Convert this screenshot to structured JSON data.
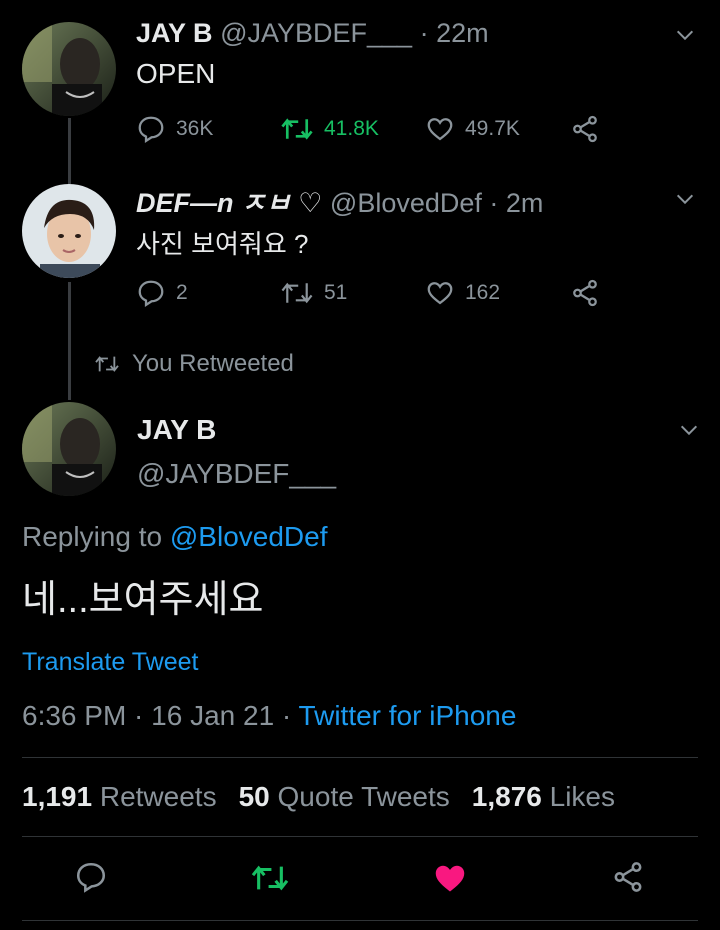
{
  "tweet1": {
    "name": "JAY B",
    "handle": "@JAYBDEF___",
    "time": "· 22m",
    "text": "OPEN",
    "replies": "36K",
    "retweets": "41.8K",
    "likes": "49.7K"
  },
  "tweet2": {
    "name": "DEF—n ㅈㅂ ♡",
    "handle": "@BlovedDef",
    "time": "· 2m",
    "text": "사진 보여줘요 ?",
    "replies": "2",
    "retweets": "51",
    "likes": "162"
  },
  "retweet_context": "You Retweeted",
  "main_tweet": {
    "name": "JAY B",
    "handle": "@JAYBDEF___",
    "replying_prefix": "Replying to",
    "replying_to": "@BlovedDef",
    "text": "네...보여주세요",
    "translate": "Translate Tweet",
    "datetime": "6:36 PM · 16 Jan 21 ·",
    "source": "Twitter for iPhone"
  },
  "stats": {
    "retweets_count": "1,191",
    "retweets_label": "Retweets",
    "quotes_count": "50",
    "quotes_label": "Quote Tweets",
    "likes_count": "1,876",
    "likes_label": "Likes"
  },
  "colors": {
    "background": "#000000",
    "retweet_green": "#17bf63",
    "like_pink": "#f91880",
    "link_blue": "#1d9bf0",
    "muted_gray": "#8b949b"
  }
}
